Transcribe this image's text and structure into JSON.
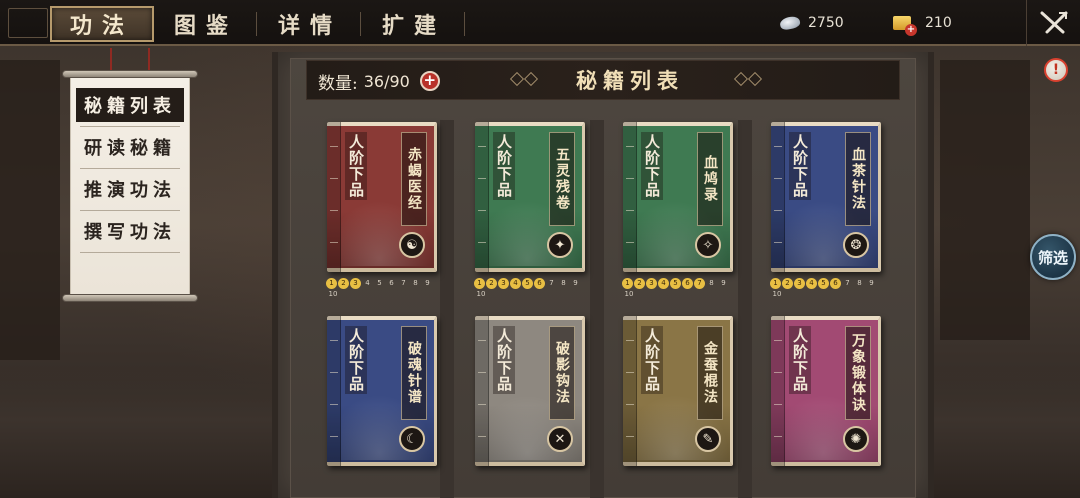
{
  "tabs": [
    {
      "label": "功法",
      "active": true
    },
    {
      "label": "图鉴",
      "active": false
    },
    {
      "label": "详情",
      "active": false
    },
    {
      "label": "扩建",
      "active": false
    }
  ],
  "currency": {
    "silver": {
      "icon": "silver-ingot-icon",
      "value": "2750"
    },
    "gold": {
      "icon": "gold-ingot-add-icon",
      "value": "210"
    }
  },
  "close_icon": "crossed-swords-close-icon",
  "side_menu": [
    {
      "label": "秘籍列表",
      "active": true
    },
    {
      "label": "研读秘籍",
      "active": false
    },
    {
      "label": "推演功法",
      "active": false
    },
    {
      "label": "撰写功法",
      "active": false
    }
  ],
  "panel": {
    "count_label": "数量:",
    "count_value": "36/90",
    "title": "秘籍列表"
  },
  "filter_label": "筛选",
  "alert_label": "!",
  "books": [
    {
      "grade": "人阶下品",
      "name": "赤蝎医经",
      "color": "#8a3a36",
      "levels_done": 3
    },
    {
      "grade": "人阶下品",
      "name": "五灵残卷",
      "color": "#3f7a52",
      "levels_done": 6
    },
    {
      "grade": "人阶下品",
      "name": "血鸠录",
      "color": "#3f7a52",
      "levels_done": 7
    },
    {
      "grade": "人阶下品",
      "name": "血茶针法",
      "color": "#3a4b84",
      "levels_done": 6
    },
    {
      "grade": "人阶下品",
      "name": "破魂针谱",
      "color": "#3a4b84",
      "levels_done": null
    },
    {
      "grade": "人阶下品",
      "name": "破影钩法",
      "color": "#8e8880",
      "levels_done": null
    },
    {
      "grade": "人阶下品",
      "name": "金蚕棍法",
      "color": "#8a7546",
      "levels_done": null
    },
    {
      "grade": "人阶下品",
      "name": "万象锻体诀",
      "color": "#a24a73",
      "levels_done": null
    }
  ],
  "level_labels": [
    "1",
    "2",
    "3",
    "4",
    "5",
    "6",
    "7",
    "8",
    "9",
    "10"
  ]
}
